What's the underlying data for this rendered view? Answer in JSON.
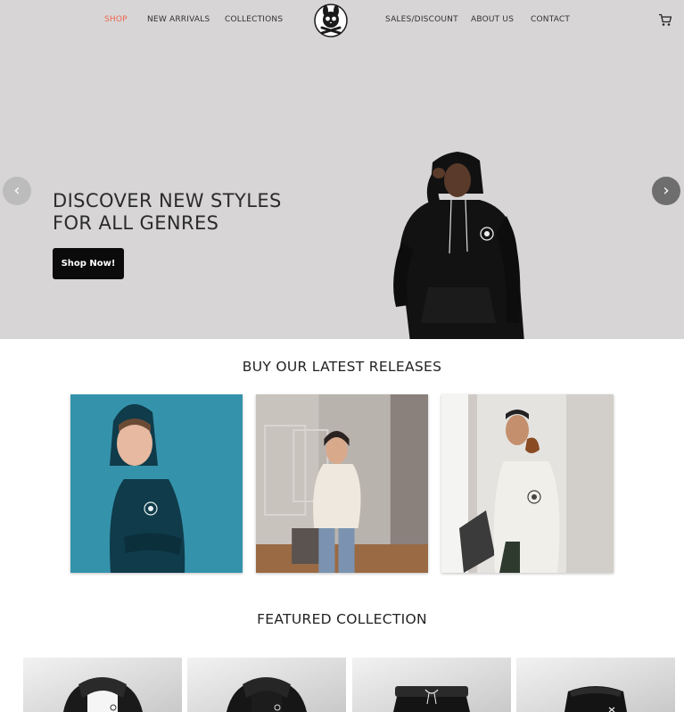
{
  "nav": {
    "left_items": [
      {
        "label": "SHOP",
        "active": true
      },
      {
        "label": "NEW ARRIVALS",
        "active": false
      },
      {
        "label": "COLLECTIONS",
        "active": false
      }
    ],
    "right_items": [
      {
        "label": "SALES/DISCOUNT",
        "active": false
      },
      {
        "label": "ABOUT US",
        "active": false
      },
      {
        "label": "CONTACT",
        "active": false
      }
    ],
    "logo_icon": "skull-bunny-logo-icon",
    "cart_icon": "shopping-cart-icon"
  },
  "hero": {
    "title": "DISCOVER NEW STYLES\nFOR ALL GENRES",
    "button_label": "Shop Now!",
    "prev_arrow": "‹",
    "next_arrow": "›",
    "background_color": "#d7d5d6"
  },
  "releases": {
    "title": "BUY OUR LATEST RELEASES",
    "items": [
      {
        "image": "boy-in-dark-teal-hoodie-photo"
      },
      {
        "image": "woman-in-cream-hoodie-photo"
      },
      {
        "image": "man-in-white-puffer-jacket-photo"
      }
    ]
  },
  "featured": {
    "title": "FEATURED COLLECTION",
    "items": [
      {
        "image": "white-black-hoodie-product"
      },
      {
        "image": "black-hoodie-product"
      },
      {
        "image": "black-joggers-product"
      },
      {
        "image": "black-leggings-product"
      }
    ]
  },
  "colors": {
    "accent": "#f0664d",
    "button": "#0b0b0b",
    "hero_bg": "#d7d5d6"
  }
}
